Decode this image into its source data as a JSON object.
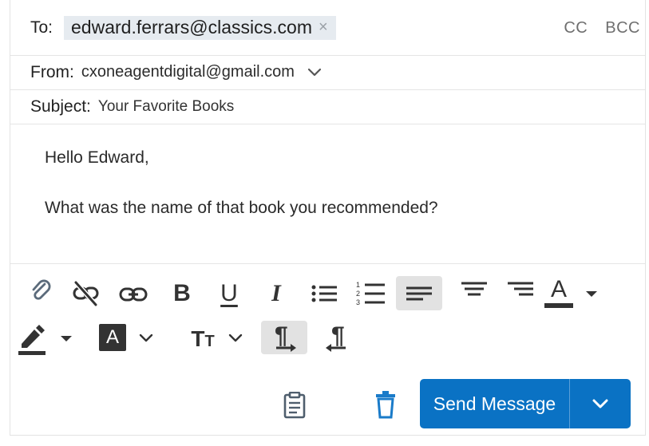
{
  "to": {
    "label": "To:",
    "recipients": [
      {
        "email": "edward.ferrars@classics.com",
        "remove": "×"
      }
    ],
    "cc_label": "CC",
    "bcc_label": "BCC"
  },
  "from": {
    "label": "From:",
    "value": "cxoneagentdigital@gmail.com"
  },
  "subject": {
    "label": "Subject:",
    "value": "Your Favorite Books"
  },
  "body": {
    "lines": [
      "Hello Edward,",
      "What was the name of that book you recommended?"
    ]
  },
  "toolbar": {
    "icons": [
      "attach-icon",
      "unlink-icon",
      "link-icon",
      "bold-icon",
      "underline-icon",
      "italic-icon",
      "bulleted-list-icon",
      "numbered-list-icon",
      "align-left-icon",
      "align-center-icon",
      "align-right-icon",
      "font-color-icon",
      "highlight-icon",
      "background-color-icon",
      "font-size-icon",
      "ltr-icon",
      "rtl-icon"
    ],
    "bold_glyph": "B",
    "underline_glyph": "U",
    "italic_glyph": "I",
    "font_color_glyph": "A",
    "bg_color_glyph": "A",
    "font_size_glyph_big": "T",
    "font_size_glyph_small": "T",
    "paragraph_glyph": "¶",
    "active_tools": [
      "align-left",
      "ltr"
    ]
  },
  "actions": {
    "send_label": "Send Message",
    "icons": [
      "clipboard-icon",
      "trash-icon"
    ]
  },
  "colors": {
    "accent": "#0a72c4",
    "icon_gray": "#3c3c3c",
    "icon_blue": "#1a7bc9",
    "chip_bg": "#e6ebf0"
  }
}
